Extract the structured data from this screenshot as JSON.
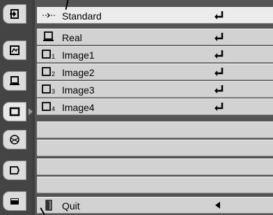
{
  "tabs": [
    {
      "name": "input-icon"
    },
    {
      "name": "pc-adjust-icon"
    },
    {
      "name": "image-select-icon"
    },
    {
      "name": "image-adjust-icon"
    },
    {
      "name": "screen-icon"
    },
    {
      "name": "setting-icon"
    },
    {
      "name": "information-icon"
    }
  ],
  "menu": {
    "items": [
      {
        "label": "Standard",
        "icon": "standard-icon",
        "action": "enter-icon"
      },
      {
        "label": "Real",
        "icon": "real-icon",
        "action": "enter-icon"
      },
      {
        "label": "Image1",
        "icon": "image-icon",
        "index": "1",
        "action": "enter-icon"
      },
      {
        "label": "Image2",
        "icon": "image-icon",
        "index": "2",
        "action": "enter-icon"
      },
      {
        "label": "Image3",
        "icon": "image-icon",
        "index": "3",
        "action": "enter-icon"
      },
      {
        "label": "Image4",
        "icon": "image-icon",
        "index": "4",
        "action": "enter-icon"
      }
    ],
    "quit_label": "Quit"
  },
  "colors": {
    "background": "#3e3e3e",
    "row": "#d2d2d2",
    "row_selected": "#ececec",
    "tab": "#dcdcdc"
  }
}
